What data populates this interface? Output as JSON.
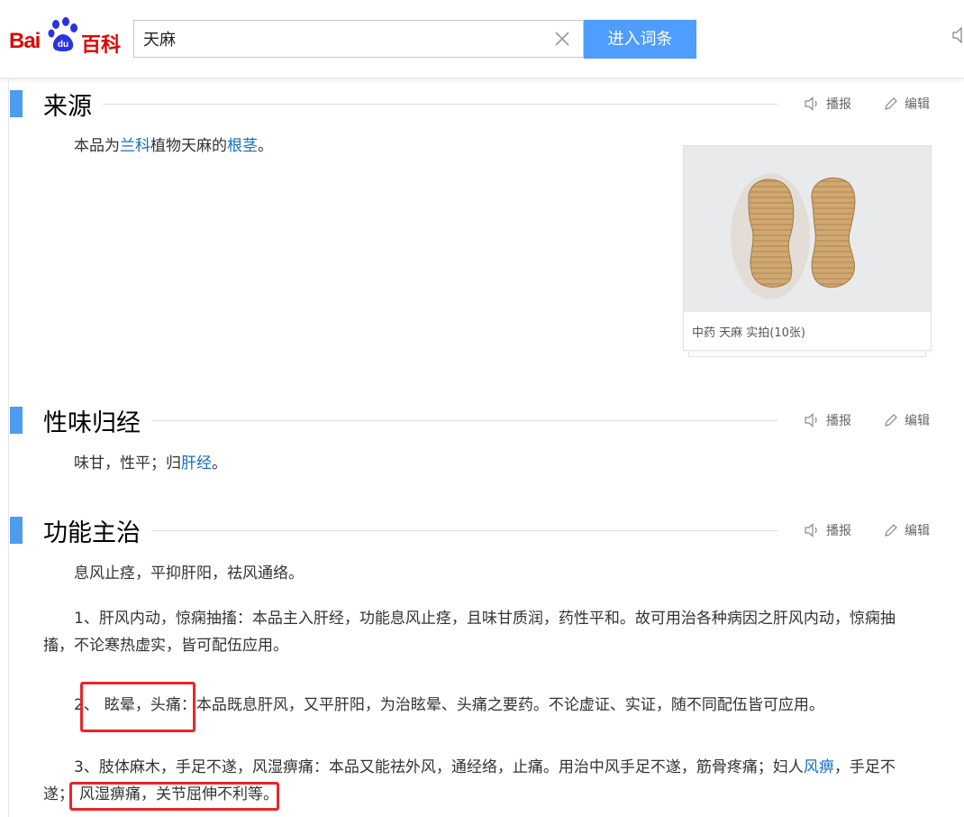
{
  "header": {
    "logo_bai": "Bai",
    "logo_du": "du",
    "logo_baike": "百科",
    "search_value": "天麻",
    "search_button": "进入词条"
  },
  "tools": {
    "listen": "播报",
    "edit": "编辑"
  },
  "sections": {
    "source": {
      "title": "来源",
      "text_pre": "本品为",
      "link1": "兰科",
      "text_mid": "植物天麻的",
      "link2": "根茎",
      "text_post": "。"
    },
    "nature": {
      "title": "性味归经",
      "text_pre": "味甘，性平；归",
      "link": "肝经",
      "text_post": "。"
    },
    "function": {
      "title": "功能主治",
      "summary": "息风止痉，平抑肝阳，祛风通络。",
      "p1_line1": "1、肝风内动，惊痫抽搐：本品主入肝经，功能息风止痉，且味甘质润，药性平和。故可用治各种病因之肝风内动，惊痫抽",
      "p1_line2": "搐，不论寒热虚实，皆可配伍应用。",
      "p2_num": "2、",
      "p2_head": "眩晕，头痛：",
      "p2_rest": "本品既息肝风，又平肝阳，为治眩晕、头痛之要药。不论虚证、实证，随不同配伍皆可应用。",
      "p3_line1_pre": "3、肢体麻木，手足不遂，风湿痹痛：本品又能祛外风，通经络，止痛。用治中风手足不遂，筋骨疼痛；妇人",
      "p3_link": "风痹",
      "p3_line1_post": "，手足不",
      "p3_line2_pre": "遂；",
      "p3_line2_hl": "风湿痹痛，关节屈伸不利等。"
    }
  },
  "image_card": {
    "caption": "中药 天麻 实拍(10张)"
  },
  "colors": {
    "accent": "#4f9cee",
    "link": "#136ec2",
    "highlight": "#e8262b",
    "button": "#4e9dff",
    "brand": "#e10602"
  }
}
